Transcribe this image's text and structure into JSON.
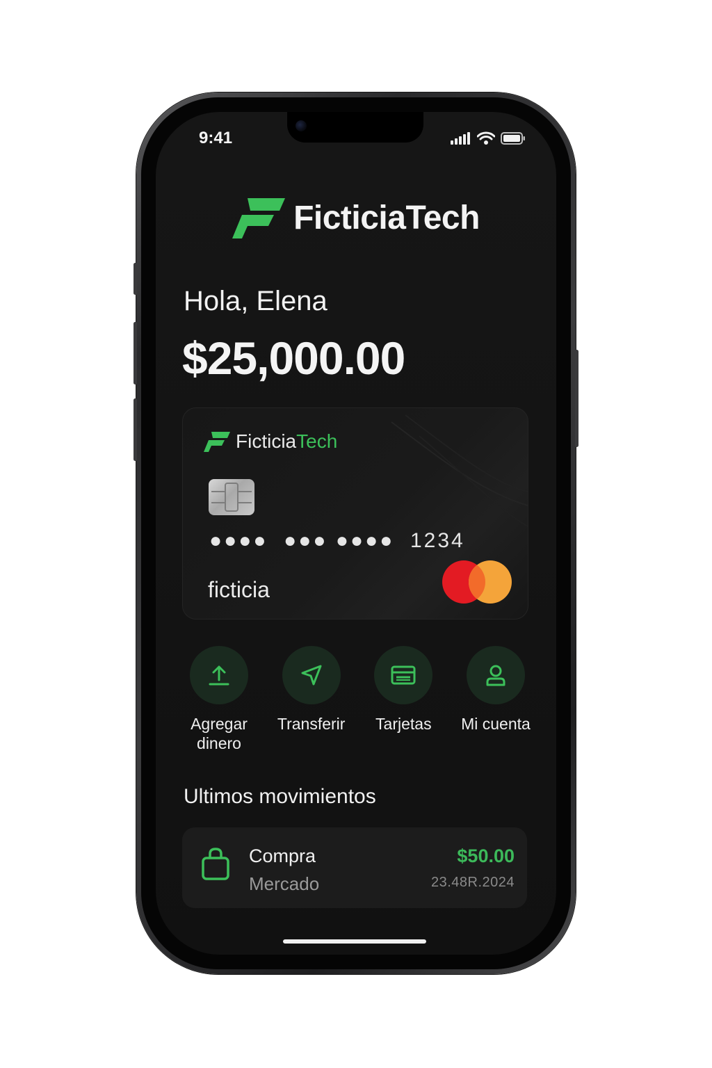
{
  "status_bar": {
    "time": "9:41"
  },
  "header": {
    "brand": "FicticiaTech"
  },
  "greeting": "Hola, Elena",
  "balance": "$25,000.00",
  "card": {
    "brand_part1": "Ficticia",
    "brand_part2": "Tech",
    "number_masked": "●●●●  ●●● ●●●●  1234",
    "holder": "ficticia",
    "network": "mastercard"
  },
  "actions": [
    {
      "label": "Agregar dinero",
      "icon": "upload-icon"
    },
    {
      "label": "Transferir",
      "icon": "send-icon"
    },
    {
      "label": "Tarjetas",
      "icon": "card-icon"
    },
    {
      "label": "Mi cuenta",
      "icon": "user-icon"
    }
  ],
  "recent": {
    "title": "Ultimos movimientos",
    "items": [
      {
        "title": "Compra",
        "subtitle": "Mercado",
        "amount": "$50.00",
        "date": "23.48R.2024",
        "icon": "shopping-bag-icon"
      }
    ]
  },
  "colors": {
    "accent": "#3cc05a",
    "background": "#141414",
    "card": "#1a1a1a",
    "mastercard_red": "#e31b23",
    "mastercard_orange": "#f4a43a"
  }
}
